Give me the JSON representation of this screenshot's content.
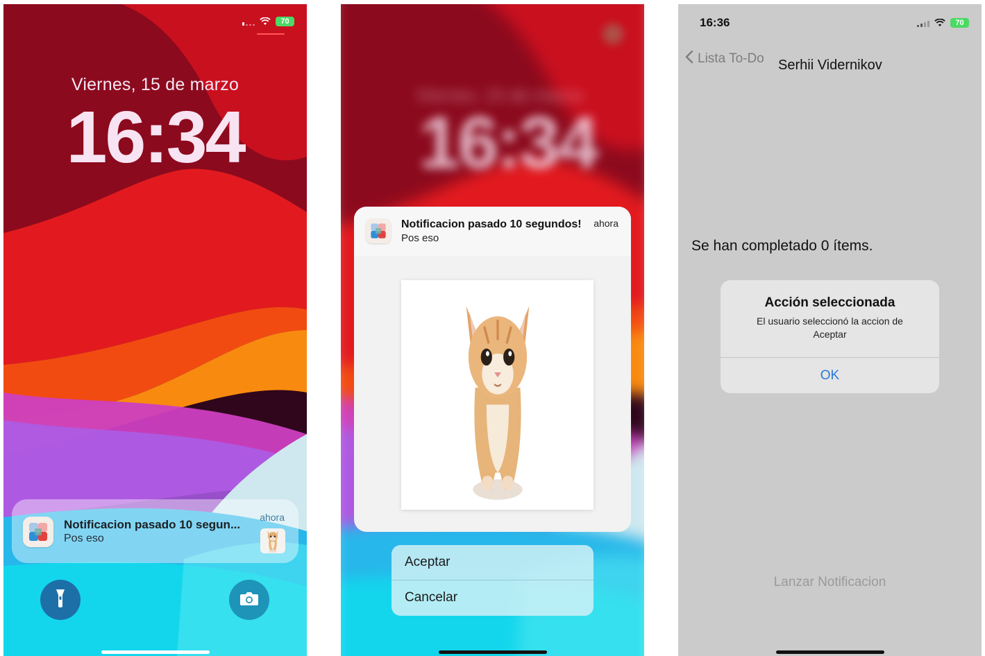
{
  "lock_screen": {
    "date": "Viernes, 15 de marzo",
    "time": "16:34",
    "status": {
      "battery": "70"
    },
    "notification": {
      "title": "Notificacion pasado 10 segun...",
      "body": "Pos eso",
      "time": "ahora"
    },
    "buttons": [
      "flashlight-icon",
      "camera-icon"
    ]
  },
  "expanded_notification": {
    "background_time": "16:34",
    "title": "Notificacion pasado 10 segundos!",
    "body": "Pos eso",
    "time": "ahora",
    "attachment": "kitten-image",
    "actions": [
      {
        "label": "Aceptar"
      },
      {
        "label": "Cancelar"
      }
    ]
  },
  "app_screen": {
    "status_time": "16:36",
    "status": {
      "battery": "70"
    },
    "back_label": "Lista To-Do",
    "nav_title": "Serhii Vidernikov",
    "completed_text": "Se han completado 0 ítems.",
    "alert": {
      "title": "Acción seleccionada",
      "message": "El usuario seleccionó la accion de Aceptar",
      "ok_label": "OK"
    },
    "launch_button": "Lanzar Notificacion"
  },
  "colors": {
    "battery_green": "#4cd964",
    "ios_blue": "#2b78d7",
    "app_background": "#cbcbcb"
  }
}
